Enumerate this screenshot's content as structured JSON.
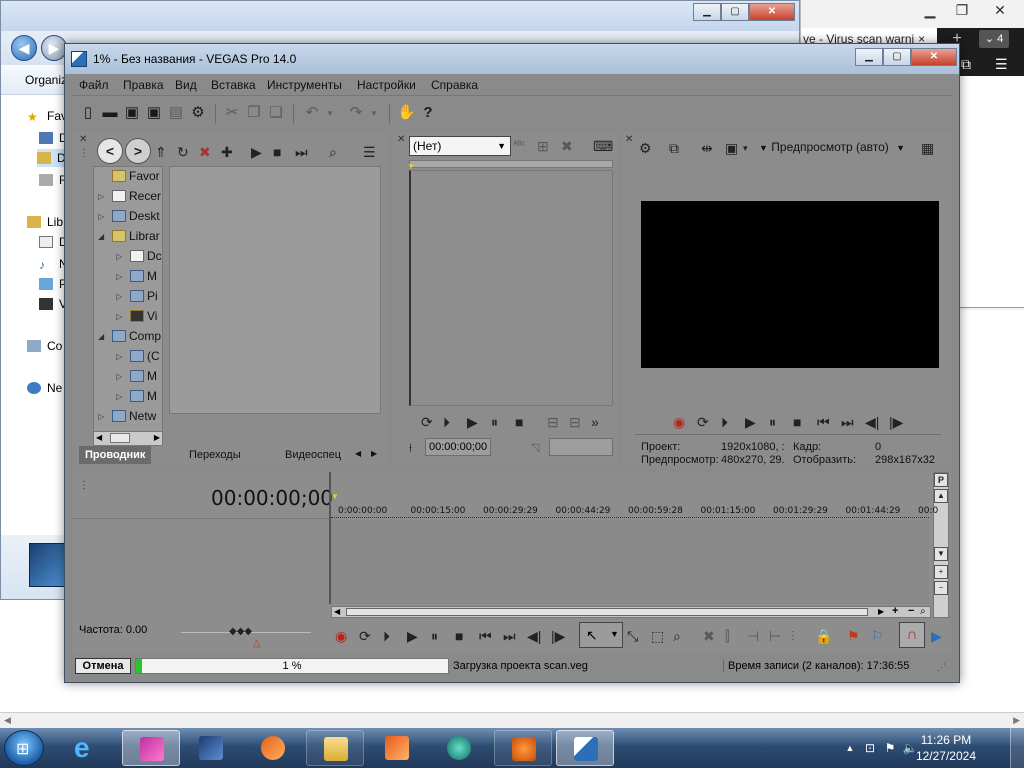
{
  "background_browser": {
    "tab_title": "ve - Virus scan warni",
    "tab_close": "×",
    "new_tab": "+",
    "tab_count": "4"
  },
  "background_explorer": {
    "organize_label": "Organiz",
    "nav_items": [
      "Fav",
      "D",
      "D",
      "R",
      "Lib",
      "D",
      "N",
      "P",
      "V",
      "Co",
      "Ne"
    ]
  },
  "vegas": {
    "title": "1% - Без названия - VEGAS Pro 14.0",
    "menu": [
      "Файл",
      "Правка",
      "Вид",
      "Вставка",
      "Инструменты",
      "Настройки",
      "Справка"
    ],
    "explorer_tree": [
      "Favor",
      "Recer",
      "Deskt",
      "Librar",
      "Dc",
      "M",
      "Pi",
      "Vi",
      "Comp",
      "(C",
      "M",
      "M",
      "Netw"
    ],
    "bottom_tabs": [
      "Проводник",
      "Переходы",
      "Видеоспец"
    ],
    "trimmer_dropdown": "(Нет)",
    "trimmer_timecode": "00:00:00;00",
    "preview_dropdown": "Предпросмотр (авто)",
    "preview_info": {
      "project_label": "Проект:",
      "project_value": "1920x1080, :",
      "frame_label": "Кадр:",
      "frame_value": "0",
      "preview_label": "Предпросмотр:",
      "preview_value": "480x270, 29.",
      "display_label": "Отобразить:",
      "display_value": "298x167x32"
    },
    "timeline_timecode": "00:00:00;00",
    "ruler": [
      "0:00:00:00",
      "00:00:15:00",
      "00:00:29:29",
      "00:00:44:29",
      "00:00:59:28",
      "00:01:15:00",
      "00:01:29:29",
      "00:01:44:29",
      "00:0"
    ],
    "rate_label": "Частота: 0.00",
    "status": {
      "cancel": "Отмена",
      "progress_value": 0.01,
      "progress_text": "1 %",
      "message": "Загрузка проекта scan.veg",
      "record_time": "Время записи (2 каналов): 17:36:55"
    }
  },
  "taskbar": {
    "time": "11:26 PM",
    "date": "12/27/2024"
  }
}
